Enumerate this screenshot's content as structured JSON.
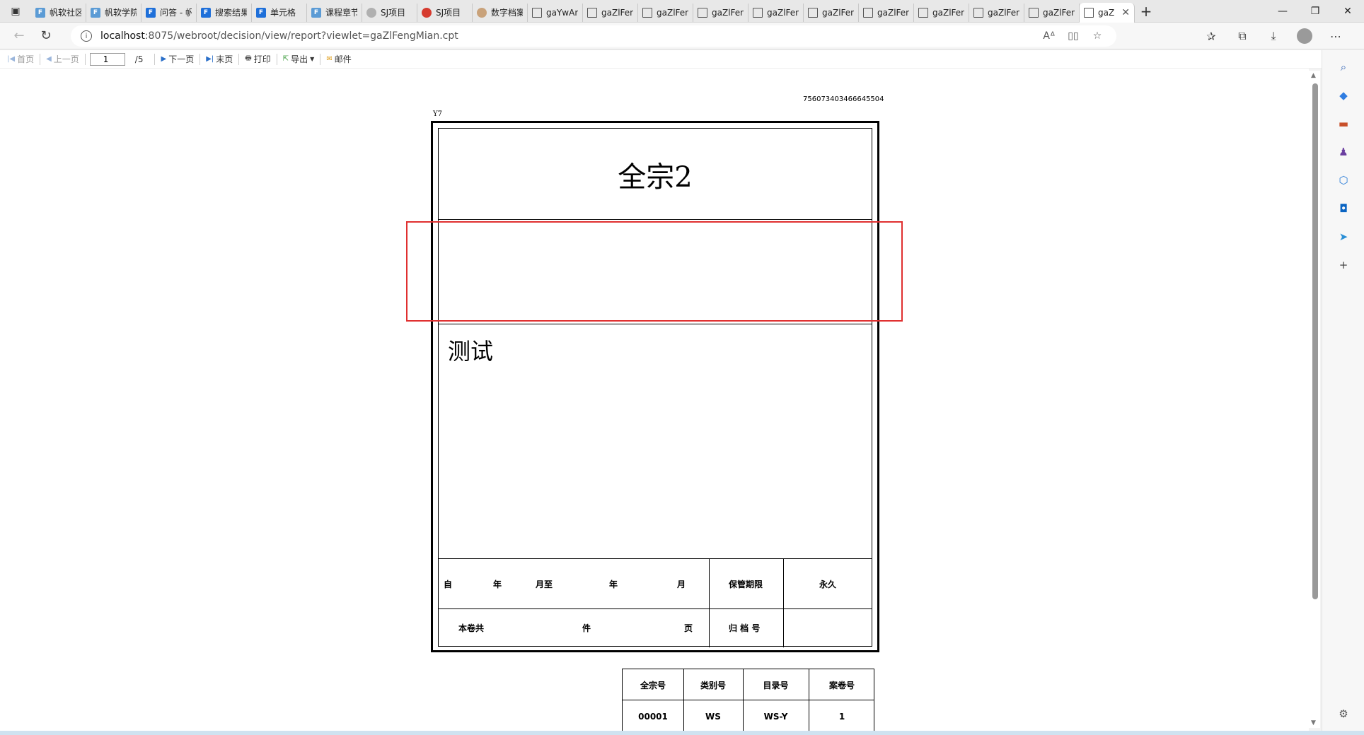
{
  "browser": {
    "tabs": [
      {
        "label": "帆软社区",
        "icon": "frl"
      },
      {
        "label": "帆软学院",
        "icon": "frl"
      },
      {
        "label": "问答 - 帆",
        "icon": "fr"
      },
      {
        "label": "搜索结果",
        "icon": "fr"
      },
      {
        "label": "单元格",
        "icon": "fr"
      },
      {
        "label": "课程章节",
        "icon": "frl"
      },
      {
        "label": "SJ项目",
        "icon": "sj1"
      },
      {
        "label": "SJ项目",
        "icon": "sj2"
      },
      {
        "label": "数字档案",
        "icon": "num"
      },
      {
        "label": "gaYwAr",
        "icon": "doc"
      },
      {
        "label": "gaZlFen",
        "icon": "doc"
      },
      {
        "label": "gaZlFen",
        "icon": "doc"
      },
      {
        "label": "gaZlFen",
        "icon": "doc"
      },
      {
        "label": "gaZlFen",
        "icon": "doc"
      },
      {
        "label": "gaZlFen",
        "icon": "doc"
      },
      {
        "label": "gaZlFen",
        "icon": "doc"
      },
      {
        "label": "gaZlFen",
        "icon": "doc"
      },
      {
        "label": "gaZlFen",
        "icon": "doc"
      },
      {
        "label": "gaZlFen",
        "icon": "doc"
      }
    ],
    "active_tab_label": "gaZ",
    "url_host": "localhost",
    "url_path": ":8075/webroot/decision/view/report?viewlet=gaZlFengMian.cpt"
  },
  "toolbar": {
    "first": "首页",
    "prev": "上一页",
    "page_value": "1",
    "page_total": "/5",
    "next": "下一页",
    "last": "末页",
    "print": "打印",
    "export": "导出",
    "mail": "邮件"
  },
  "report": {
    "barcode_text": "756073403466645504",
    "small_label": "Y7",
    "title": "全宗2",
    "body_text": "测试",
    "row1": {
      "zi": "自",
      "nian1": "年",
      "yuezhi": "月至",
      "nian2": "年",
      "yue": "月",
      "retention_label": "保管期限",
      "retention_value": "永久"
    },
    "row2": {
      "benjuangong": "本卷共",
      "jian": "件",
      "ye": "页",
      "archive_label": "归 档 号",
      "archive_value": ""
    },
    "id_table": {
      "headers": [
        "全宗号",
        "类别号",
        "目录号",
        "案卷号"
      ],
      "values": [
        "00001",
        "WS",
        "WS-Y",
        "1"
      ]
    }
  }
}
